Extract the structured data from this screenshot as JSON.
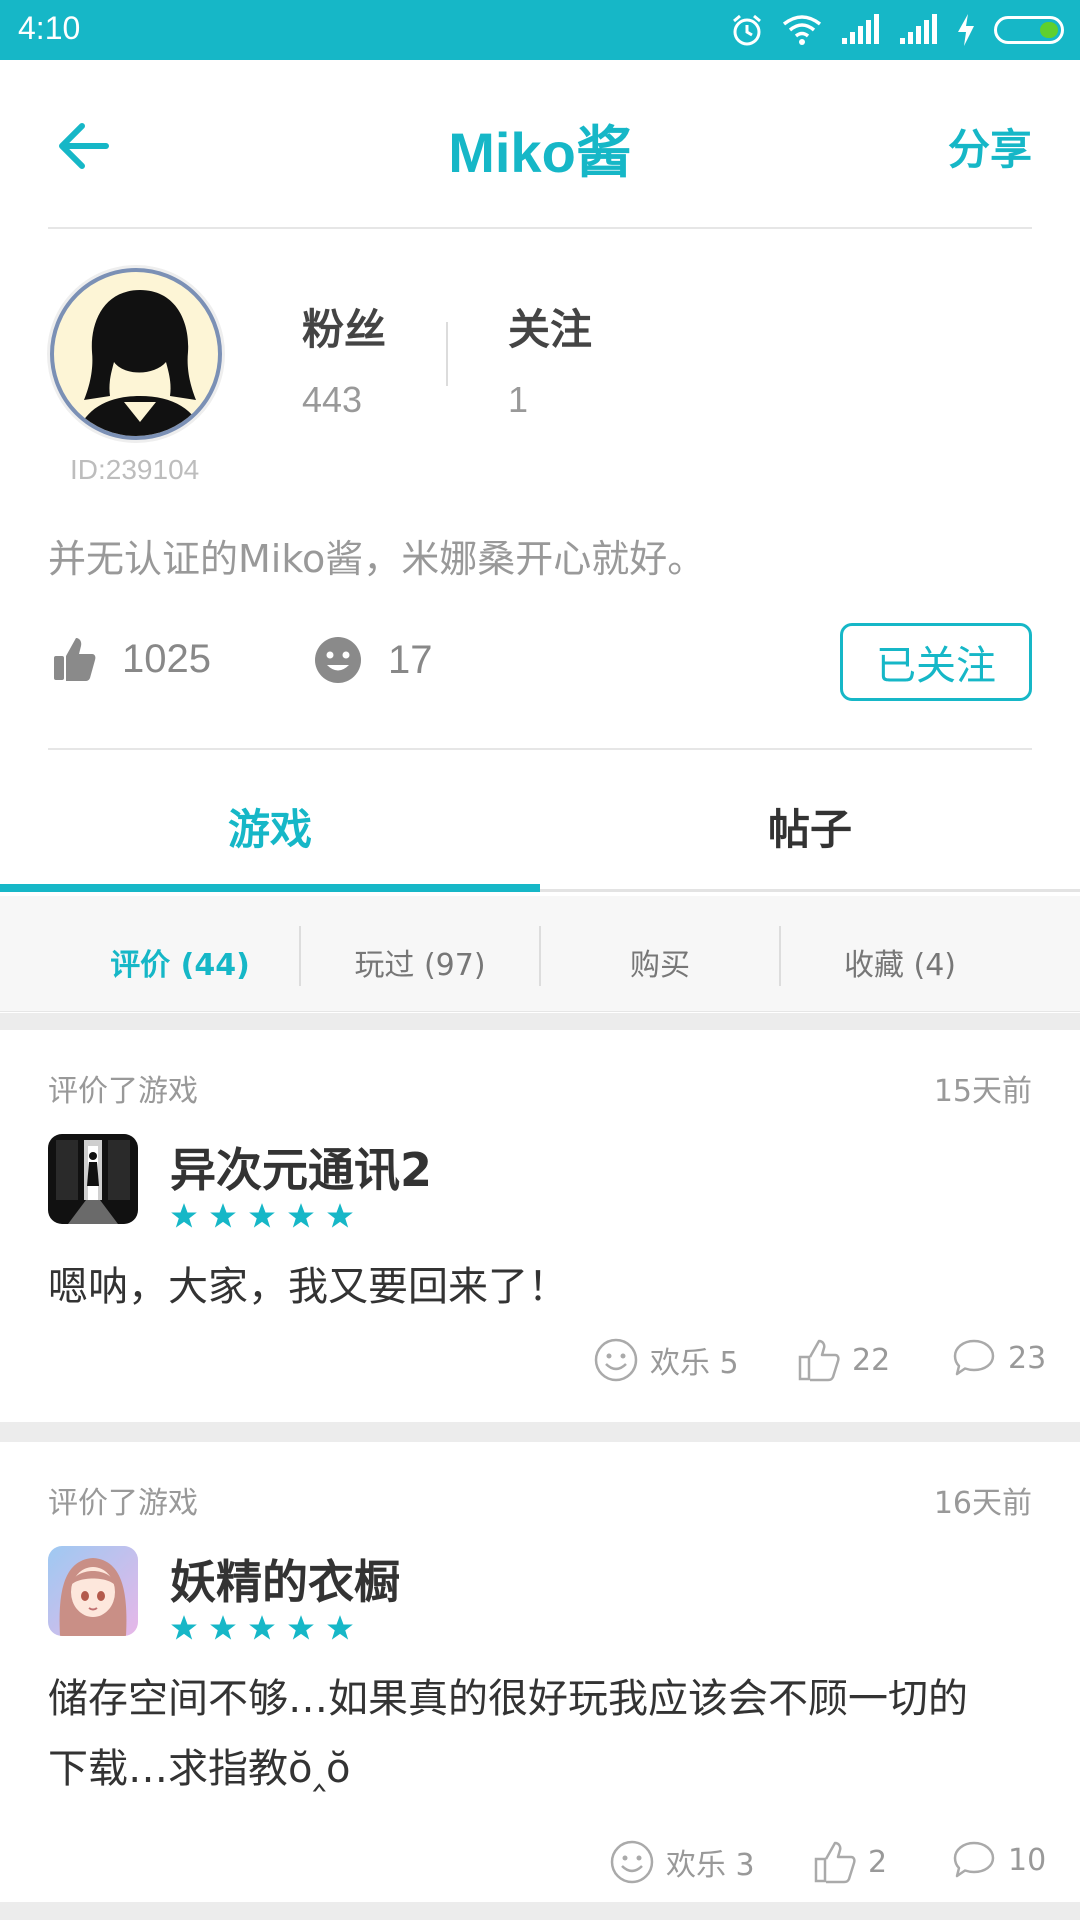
{
  "status_bar": {
    "time": "4:10",
    "accent": "#16b7c7"
  },
  "header": {
    "title": "Miko酱",
    "share_label": "分享"
  },
  "profile": {
    "user_id": "ID:239104",
    "fans_label": "粉丝",
    "fans_count": "443",
    "following_label": "关注",
    "following_count": "1",
    "bio": "并无认证的Miko酱，米娜桑开心就好。",
    "likes_count": "1025",
    "fun_count": "17",
    "follow_button": "已关注"
  },
  "tabs": [
    {
      "label": "游戏",
      "active": true
    },
    {
      "label": "帖子",
      "active": false
    }
  ],
  "subtabs": [
    {
      "label": "评价 (44)",
      "active": true
    },
    {
      "label": "玩过 (97)",
      "active": false
    },
    {
      "label": "购买",
      "active": false
    },
    {
      "label": "收藏 (4)",
      "active": false
    }
  ],
  "reviews": [
    {
      "kind": "评价了游戏",
      "time": "15天前",
      "game": "异次元通讯2",
      "rating": 5,
      "text": "嗯呐，大家，我又要回来了！",
      "fun": "欢乐 5",
      "likes": "22",
      "comments": "23"
    },
    {
      "kind": "评价了游戏",
      "time": "16天前",
      "game": "妖精的衣橱",
      "rating": 5,
      "text_line1": "储存空间不够…如果真的很好玩我应该会不顾一切的",
      "text_line2": "下载…求指教ŏ‸ŏ",
      "fun": "欢乐 3",
      "likes": "2",
      "comments": "10"
    }
  ]
}
